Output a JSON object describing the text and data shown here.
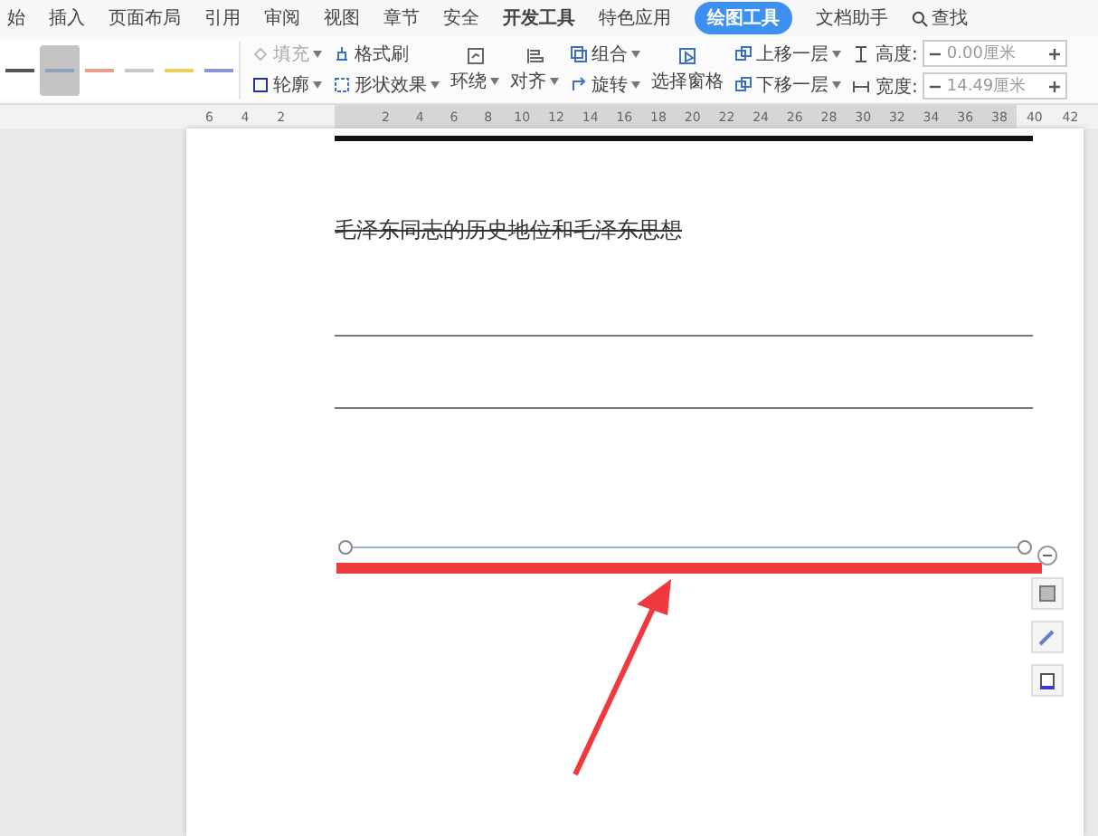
{
  "tabs": [
    {
      "label": "始",
      "selected": false
    },
    {
      "label": "插入",
      "selected": false
    },
    {
      "label": "页面布局",
      "selected": false
    },
    {
      "label": "引用",
      "selected": false
    },
    {
      "label": "审阅",
      "selected": false
    },
    {
      "label": "视图",
      "selected": false
    },
    {
      "label": "章节",
      "selected": false
    },
    {
      "label": "安全",
      "selected": false
    },
    {
      "label": "开发工具",
      "selected": false,
      "bold": true
    },
    {
      "label": "特色应用",
      "selected": false
    },
    {
      "label": "绘图工具",
      "selected": true
    },
    {
      "label": "文档助手",
      "selected": false
    },
    {
      "label": "查找",
      "selected": false,
      "kind": "search"
    }
  ],
  "line_styles": [
    {
      "color": "#555555",
      "selected": false
    },
    {
      "color": "#8fa3bd",
      "selected": true
    },
    {
      "color": "#e8a08a",
      "selected": false
    },
    {
      "color": "#c8c8c8",
      "selected": false
    },
    {
      "color": "#e8d060",
      "selected": false
    },
    {
      "color": "#8c96d8",
      "selected": false
    }
  ],
  "ribbon": {
    "fill": {
      "label": "填充",
      "disabled": true
    },
    "outline": {
      "label": "轮廓",
      "disabled": false
    },
    "format_painter": "格式刷",
    "shape_effects": "形状效果",
    "wrap": "环绕",
    "align": "对齐",
    "group": "组合",
    "rotate": "旋转",
    "selection_pane": "选择窗格",
    "bring_forward": "上移一层",
    "send_backward": "下移一层",
    "height": {
      "label": "高度:",
      "value": "0.00厘米"
    },
    "width": {
      "label": "宽度:",
      "value": "14.49厘米"
    }
  },
  "ruler": {
    "left_labels": [
      "6",
      "4",
      "2"
    ],
    "right_labels": [
      "2",
      "4",
      "6",
      "8",
      "10",
      "12",
      "14",
      "16",
      "18",
      "20",
      "22",
      "24",
      "26",
      "28",
      "30",
      "32",
      "34",
      "36",
      "38"
    ],
    "outer_labels": [
      "40",
      "42"
    ]
  },
  "document": {
    "heading": "毛泽东同志的历史地位和毛泽东思想"
  }
}
